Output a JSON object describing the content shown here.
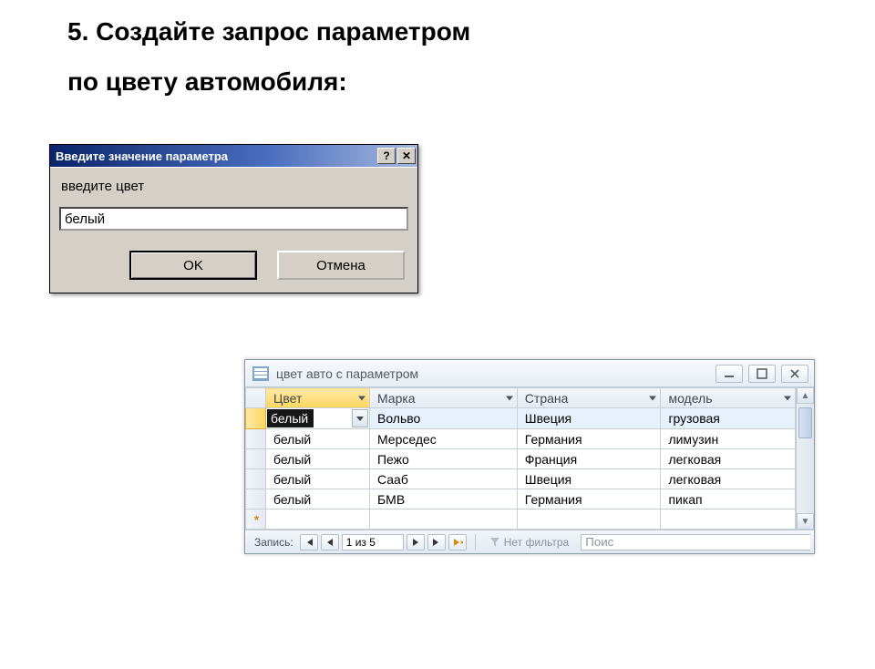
{
  "headings": {
    "line1": "5. Создайте запрос параметром",
    "line2": "по цвету автомобиля:"
  },
  "dialog": {
    "title": "Введите значение параметра",
    "help_glyph": "?",
    "close_glyph": "✕",
    "prompt": "введите цвет",
    "input_value": "белый",
    "ok_label": "OK",
    "cancel_label": "Отмена"
  },
  "results": {
    "window_title": "цвет авто с параметром",
    "columns": [
      "Цвет",
      "Марка",
      "Страна",
      "модель"
    ],
    "rows": [
      {
        "color": "белый",
        "brand": "Вольво",
        "country": "Швеция",
        "model": "грузовая"
      },
      {
        "color": "белый",
        "brand": "Мерседес",
        "country": "Германия",
        "model": "лимузин"
      },
      {
        "color": "белый",
        "brand": "Пежо",
        "country": "Франция",
        "model": "легковая"
      },
      {
        "color": "белый",
        "brand": "Сааб",
        "country": "Швеция",
        "model": "легковая"
      },
      {
        "color": "белый",
        "brand": "БМВ",
        "country": "Германия",
        "model": "пикап"
      }
    ],
    "nav": {
      "label": "Запись:",
      "position": "1 из 5",
      "filter_label": "Нет фильтра",
      "search_placeholder": "Поис"
    }
  }
}
